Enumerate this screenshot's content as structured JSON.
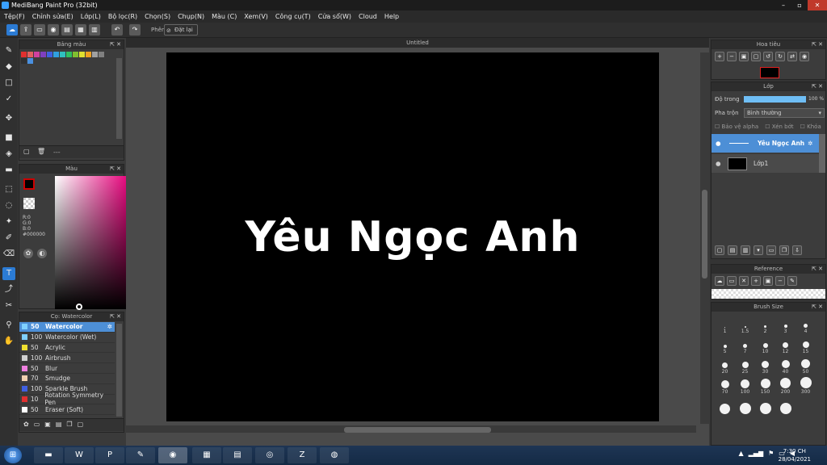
{
  "window": {
    "title": "MediBang Paint Pro (32bit)",
    "min": "–",
    "max": "▫",
    "close": "✕"
  },
  "menu": [
    "Tệp(F)",
    "Chỉnh sửa(E)",
    "Lớp(L)",
    "Bộ lọc(R)",
    "Chọn(S)",
    "Chụp(N)",
    "Màu (C)",
    "Xem(V)",
    "Công cụ(T)",
    "Cửa sổ(W)",
    "Cloud",
    "Help"
  ],
  "toolbar": {
    "label": "Phên",
    "reset_label": "Đặt lại"
  },
  "palette_panel": {
    "title": "Bảng màu",
    "footer_text": "---",
    "colors": [
      "#e03030",
      "#e06060",
      "#d040a0",
      "#8040c0",
      "#4060e0",
      "#30a0e0",
      "#30c0c0",
      "#30c060",
      "#80c030",
      "#e0e030",
      "#f0a020",
      "#a0a0a0",
      "#808080",
      "#303030",
      "#4a90e0"
    ]
  },
  "color_panel": {
    "title": "Màu",
    "r": "R:0",
    "g": "G:0",
    "b": "B:0",
    "hex": "#000000"
  },
  "brush_panel": {
    "title": "Cọ: Watercolor",
    "items": [
      {
        "size": "50",
        "name": "Watercolor",
        "color": "#7fd0ff"
      },
      {
        "size": "100",
        "name": "Watercolor (Wet)",
        "color": "#7fd0ff"
      },
      {
        "size": "50",
        "name": "Acrylic",
        "color": "#f0e030"
      },
      {
        "size": "100",
        "name": "Airbrush",
        "color": "#d0d0d0"
      },
      {
        "size": "50",
        "name": "Blur",
        "color": "#f080e0"
      },
      {
        "size": "70",
        "name": "Smudge",
        "color": "#f0d0b0"
      },
      {
        "size": "100",
        "name": "Sparkle Brush",
        "color": "#4060e0"
      },
      {
        "size": "10",
        "name": "Rotation Symmetry Pen",
        "color": "#e03030"
      },
      {
        "size": "50",
        "name": "Eraser (Soft)",
        "color": "#ffffff"
      }
    ]
  },
  "document": {
    "tab_title": "Untitled",
    "art_text": "Yêu Ngọc Anh"
  },
  "navigator": {
    "title": "Hoa tiêu"
  },
  "layers": {
    "title": "Lớp",
    "opacity_label": "Độ trong",
    "opacity_value": "100 %",
    "opacity_fraction": 1.0,
    "blend_label": "Pha trộn",
    "blend_value": "Bình thường",
    "protect_alpha": "Bảo vệ alpha",
    "clipping": "Xén bớt",
    "lock": "Khóa",
    "items": [
      {
        "name": "Yêu Ngọc Anh"
      },
      {
        "name": "Lớp1"
      }
    ]
  },
  "reference": {
    "title": "Reference"
  },
  "brush_size": {
    "title": "Brush Size",
    "sizes": [
      "1",
      "1.5",
      "2",
      "3",
      "4",
      "5",
      "7",
      "10",
      "12",
      "15",
      "20",
      "25",
      "30",
      "40",
      "50",
      "70",
      "100",
      "150",
      "200",
      "300",
      "",
      "",
      "",
      ""
    ]
  },
  "taskbar": {
    "time": "7:30 CH",
    "date": "28/04/2021"
  }
}
